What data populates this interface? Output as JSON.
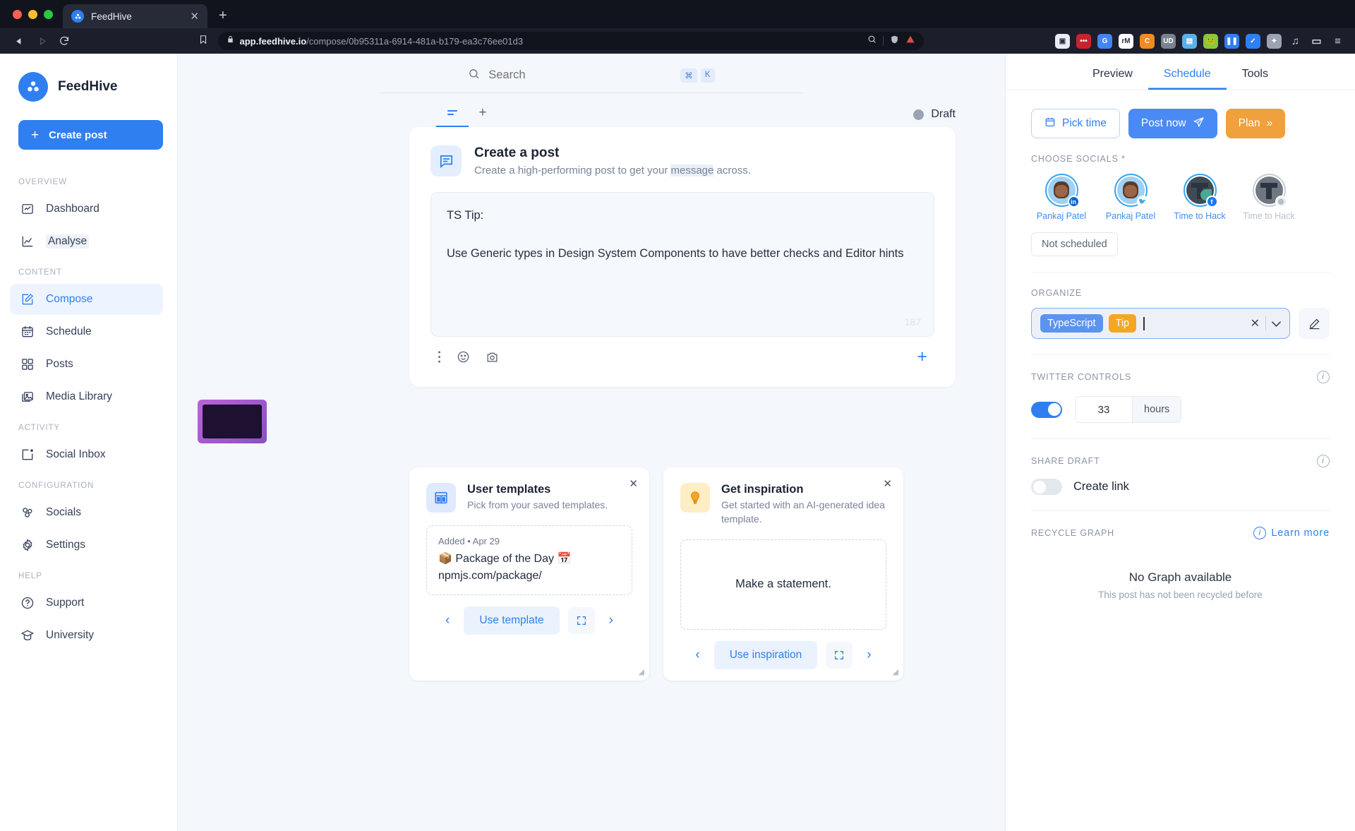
{
  "browser": {
    "tab_title": "FeedHive",
    "tab_close_glyph": "✕",
    "new_tab_glyph": "+",
    "url_domain": "app.feedhive.io",
    "url_path": "/compose/0b95311a-6914-481a-b179-ea3c76ee01d3",
    "back_glyph": "◀",
    "forward_glyph": "▷",
    "reload_glyph": "⟳",
    "extensions": [
      {
        "name": "picture-in-picture-icon",
        "color": "#e9ecf2",
        "label": "▣"
      },
      {
        "name": "notes-extension-icon",
        "color": "#c8232c",
        "label": "•••"
      },
      {
        "name": "google-translate-icon",
        "color": "#4285f4",
        "label": "G"
      },
      {
        "name": "rm-extension-icon",
        "color": "#ffffff",
        "label": "rM"
      },
      {
        "name": "c-extension-icon",
        "color": "#f08a24",
        "label": "C"
      },
      {
        "name": "ublock-origin-icon",
        "color": "#7b828f",
        "label": "UD"
      },
      {
        "name": "pocket-extension-icon",
        "color": "#5ab0e8",
        "label": "▤"
      },
      {
        "name": "frog-extension-icon",
        "color": "#8cc63f",
        "label": "🐸"
      },
      {
        "name": "pause-extension-icon",
        "color": "#2f7ff0",
        "label": "❚❚"
      },
      {
        "name": "check-extension-icon",
        "color": "#2f7ff0",
        "label": "✓"
      },
      {
        "name": "puzzle-extensions-icon",
        "color": "#9aa2b3",
        "label": "✦"
      }
    ],
    "right_icons": [
      "playlist-icon",
      "wallet-icon",
      "menu-icon"
    ]
  },
  "sidebar": {
    "brand": "FeedHive",
    "create_post_label": "Create post",
    "create_post_plus": "+",
    "groups": [
      {
        "title": "OVERVIEW",
        "items": [
          {
            "label": "Dashboard",
            "icon": "dashboard-icon",
            "state": "normal"
          },
          {
            "label": "Analyse",
            "icon": "analyse-icon",
            "state": "hover"
          }
        ]
      },
      {
        "title": "CONTENT",
        "items": [
          {
            "label": "Compose",
            "icon": "compose-icon",
            "state": "active"
          },
          {
            "label": "Schedule",
            "icon": "calendar-icon",
            "state": "normal"
          },
          {
            "label": "Posts",
            "icon": "grid-icon",
            "state": "normal"
          },
          {
            "label": "Media Library",
            "icon": "media-library-icon",
            "state": "normal"
          }
        ]
      },
      {
        "title": "ACTIVITY",
        "items": [
          {
            "label": "Social Inbox",
            "icon": "inbox-icon",
            "state": "normal"
          }
        ]
      },
      {
        "title": "CONFIGURATION",
        "items": [
          {
            "label": "Socials",
            "icon": "socials-icon",
            "state": "normal"
          },
          {
            "label": "Settings",
            "icon": "gear-icon",
            "state": "normal"
          }
        ]
      },
      {
        "title": "HELP",
        "items": [
          {
            "label": "Support",
            "icon": "support-icon",
            "state": "normal"
          },
          {
            "label": "University",
            "icon": "university-icon",
            "state": "normal"
          }
        ]
      }
    ]
  },
  "topbar": {
    "search_placeholder": "Search",
    "shortcut_keys": [
      "⌘",
      "K"
    ]
  },
  "compose": {
    "status_label": "Draft",
    "add_tab_glyph": "+",
    "title": "Create a post",
    "subtitle_before": "Create a high-performing post to get your ",
    "subtitle_highlight": "message",
    "subtitle_after": " across.",
    "editor_line_1": "TS Tip:",
    "editor_line_2": "Use Generic types in Design System Components to have better checks and Editor hints",
    "char_count": "187",
    "toolbar_icons": [
      "more-options-icon",
      "emoji-icon",
      "image-icon"
    ],
    "add_glyph": "+"
  },
  "promo_cards": [
    {
      "title": "User templates",
      "subtitle": "Pick from your saved templates.",
      "icon": "template-icon",
      "close_glyph": "✕",
      "meta": "Added • Apr 29",
      "body_line_1": "📦 Package of the Day 📅",
      "body_line_2": "npmjs.com/package/",
      "action_label": "Use template",
      "prev_glyph": "‹",
      "next_glyph": "›"
    },
    {
      "title": "Get inspiration",
      "subtitle": "Get started with an AI-generated idea template.",
      "icon": "lightbulb-icon",
      "close_glyph": "✕",
      "body_centered": "Make a statement.",
      "action_label": "Use inspiration",
      "prev_glyph": "‹",
      "next_glyph": "›"
    }
  ],
  "right_panel": {
    "tabs": [
      {
        "label": "Preview",
        "active": false
      },
      {
        "label": "Schedule",
        "active": true
      },
      {
        "label": "Tools",
        "active": false
      }
    ],
    "actions": {
      "pick_time": "Pick time",
      "post_now": "Post now",
      "plan": "Plan",
      "plan_chevrons": "»"
    },
    "choose_socials_label": "CHOOSE SOCIALS *",
    "socials": [
      {
        "name": "Pankaj Patel",
        "network": "linkedin",
        "selected": true
      },
      {
        "name": "Pankaj Patel",
        "network": "twitter",
        "selected": true
      },
      {
        "name": "Time to Hack",
        "network": "facebook",
        "selected": true
      },
      {
        "name": "Time to Hack",
        "network": "instagram",
        "selected": false
      }
    ],
    "not_scheduled_label": "Not scheduled",
    "organize_label": "ORGANIZE",
    "tags": [
      {
        "text": "TypeScript",
        "color": "blue"
      },
      {
        "text": "Tip",
        "color": "amber"
      }
    ],
    "tag_clear_glyph": "✕",
    "tag_chevron_glyph": "⌄",
    "twitter_controls_label": "TWITTER CONTROLS",
    "twitter_toggle_on": true,
    "twitter_value": "33",
    "twitter_unit": "hours",
    "share_draft_label": "SHARE DRAFT",
    "create_link_label": "Create link",
    "create_link_on": false,
    "recycle_graph_label": "RECYCLE GRAPH",
    "learn_more_label": "Learn more",
    "no_graph_title": "No Graph available",
    "no_graph_sub": "This post has not been recycled before"
  },
  "colors": {
    "accent": "#2f7ff0",
    "amber": "#f0a03c",
    "tag_blue": "#5b94f0",
    "tag_amber": "#f5a623",
    "chrome_bg": "#1c1f2b",
    "app_bg": "#f4f7fb"
  }
}
